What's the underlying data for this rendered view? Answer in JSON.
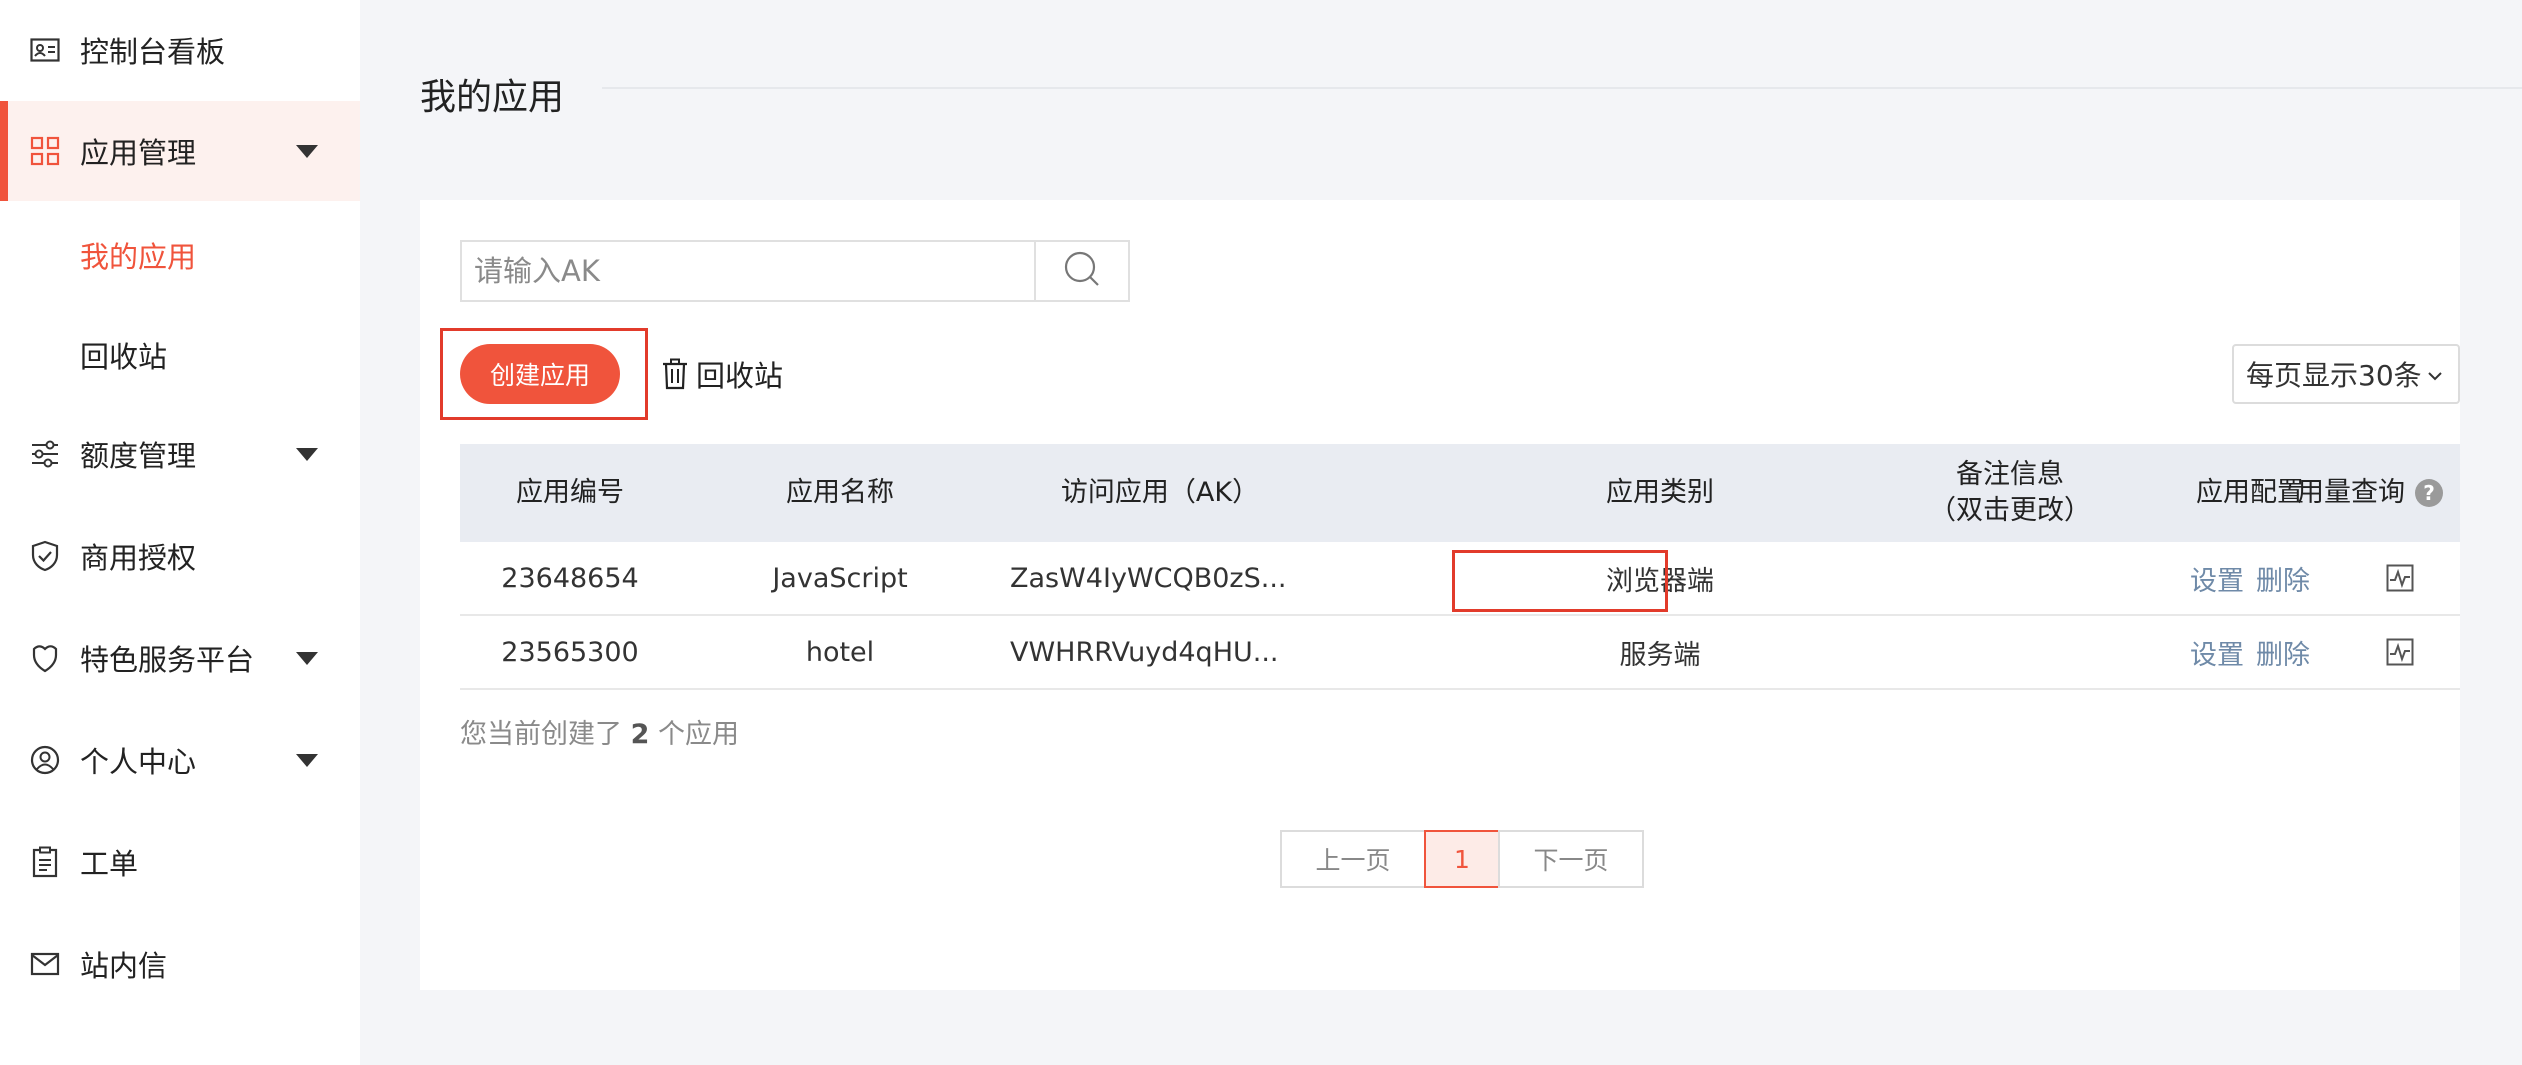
{
  "sidebar": {
    "items": [
      {
        "label": "控制台看板",
        "icon": "id-card-icon"
      },
      {
        "label": "应用管理",
        "icon": "grid-icon"
      },
      {
        "label": "额度管理",
        "icon": "sliders-icon"
      },
      {
        "label": "商用授权",
        "icon": "shield-icon"
      },
      {
        "label": "特色服务平台",
        "icon": "heart-shield-icon"
      },
      {
        "label": "个人中心",
        "icon": "user-circle-icon"
      },
      {
        "label": "工单",
        "icon": "clipboard-icon"
      },
      {
        "label": "站内信",
        "icon": "mail-icon"
      }
    ],
    "sub_items": [
      {
        "label": "我的应用"
      },
      {
        "label": "回收站"
      }
    ]
  },
  "page": {
    "title": "我的应用"
  },
  "toolbar": {
    "search_placeholder": "请输入AK",
    "search_icon": "search-icon",
    "create_label": "创建应用",
    "recycle_label": "回收站",
    "page_size_label": "每页显示30条"
  },
  "table": {
    "columns": [
      "应用编号",
      "应用名称",
      "访问应用（AK）",
      "应用类别",
      "备注信息",
      "（双击更改）",
      "应用配置",
      "用量查询"
    ],
    "rows": [
      {
        "id": "23648654",
        "name": "JavaScript",
        "ak": "ZasW4IyWCQB0zS...",
        "type": "浏览器端",
        "note": "",
        "set": "设置",
        "del": "删除"
      },
      {
        "id": "23565300",
        "name": "hotel",
        "ak": "VWHRRVuyd4qHU...",
        "type": "服务端",
        "note": "",
        "set": "设置",
        "del": "删除"
      }
    ]
  },
  "summary": {
    "prefix": "您当前创建了",
    "count": "2",
    "suffix": "个应用"
  },
  "pagination": {
    "prev": "上一页",
    "current": "1",
    "next": "下一页"
  },
  "colors": {
    "accent": "#f0543c",
    "highlight_border": "#e23b2b",
    "link": "#6f8aa8"
  }
}
